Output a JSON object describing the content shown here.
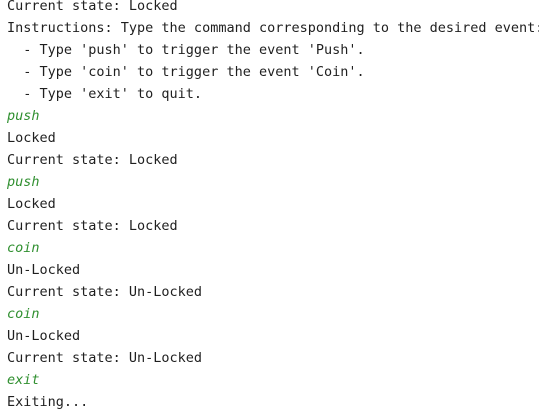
{
  "console": {
    "colors": {
      "output_text": "#1f1f1f",
      "user_input": "#2f8f2f",
      "background": "#ffffff"
    },
    "lines": [
      {
        "text": "Current state: Locked",
        "kind": "output"
      },
      {
        "text": "Instructions: Type the command corresponding to the desired event:",
        "kind": "output"
      },
      {
        "text": "  - Type 'push' to trigger the event 'Push'.",
        "kind": "output"
      },
      {
        "text": "  - Type 'coin' to trigger the event 'Coin'.",
        "kind": "output"
      },
      {
        "text": "  - Type 'exit' to quit.",
        "kind": "output"
      },
      {
        "text": "push",
        "kind": "input"
      },
      {
        "text": "Locked",
        "kind": "output"
      },
      {
        "text": "Current state: Locked",
        "kind": "output"
      },
      {
        "text": "push",
        "kind": "input"
      },
      {
        "text": "Locked",
        "kind": "output"
      },
      {
        "text": "Current state: Locked",
        "kind": "output"
      },
      {
        "text": "coin",
        "kind": "input"
      },
      {
        "text": "Un-Locked",
        "kind": "output"
      },
      {
        "text": "Current state: Un-Locked",
        "kind": "output"
      },
      {
        "text": "coin",
        "kind": "input"
      },
      {
        "text": "Un-Locked",
        "kind": "output"
      },
      {
        "text": "Current state: Un-Locked",
        "kind": "output"
      },
      {
        "text": "exit",
        "kind": "input"
      },
      {
        "text": "Exiting...",
        "kind": "output"
      }
    ]
  }
}
